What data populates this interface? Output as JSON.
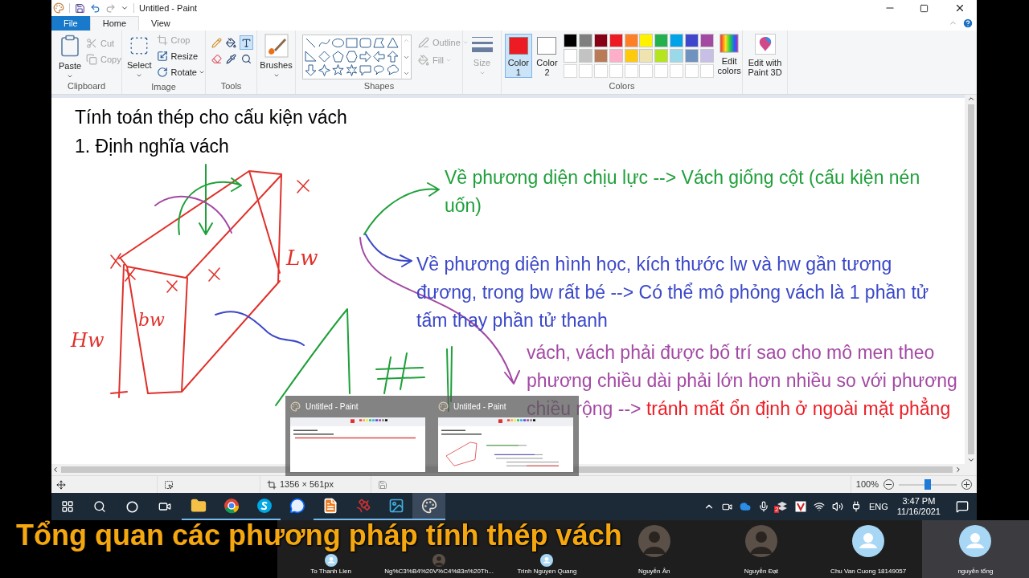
{
  "window": {
    "title": "Untitled - Paint"
  },
  "menu_tabs": [
    {
      "label": "File",
      "kind": "file",
      "selected": false
    },
    {
      "label": "Home",
      "kind": "tab",
      "selected": true
    },
    {
      "label": "View",
      "kind": "tab",
      "selected": false
    }
  ],
  "ribbon": {
    "clipboard": {
      "label": "Clipboard",
      "paste": "Paste",
      "cut": {
        "label": "Cut",
        "disabled": true
      },
      "copy": {
        "label": "Copy",
        "disabled": true
      }
    },
    "image": {
      "label": "Image",
      "select": "Select",
      "crop": {
        "label": "Crop",
        "disabled": true
      },
      "resize": {
        "label": "Resize",
        "disabled": false
      },
      "rotate": {
        "label": "Rotate",
        "disabled": false
      }
    },
    "tools": {
      "label": "Tools",
      "items": [
        {
          "kind": "pencil",
          "selected": false
        },
        {
          "kind": "fill",
          "selected": false
        },
        {
          "kind": "text",
          "selected": true
        },
        {
          "kind": "eraser",
          "selected": false
        },
        {
          "kind": "picker",
          "selected": false
        },
        {
          "kind": "magnifier",
          "selected": false
        }
      ]
    },
    "brushes": "Brushes",
    "shapes": {
      "label": "Shapes",
      "outline": {
        "label": "Outline",
        "disabled": true
      },
      "fill": {
        "label": "Fill",
        "disabled": true
      }
    },
    "size": {
      "label": "Size",
      "disabled": true
    },
    "colors": {
      "label": "Colors",
      "color1": {
        "label": "Color 1",
        "color": "#ed1c24",
        "selected": true
      },
      "color2": {
        "label": "Color 2",
        "color": "#ffffff",
        "selected": false
      },
      "palette": [
        {
          "color": "#000000"
        },
        {
          "color": "#7f7f7f"
        },
        {
          "color": "#880015"
        },
        {
          "color": "#ed1c24"
        },
        {
          "color": "#ff7f27"
        },
        {
          "color": "#fff200"
        },
        {
          "color": "#22b14c"
        },
        {
          "color": "#00a2e8"
        },
        {
          "color": "#3f48cc"
        },
        {
          "color": "#a349a4"
        },
        {
          "color": "#ffffff"
        },
        {
          "color": "#c3c3c3"
        },
        {
          "color": "#b97a57"
        },
        {
          "color": "#ffaec9"
        },
        {
          "color": "#ffc90e"
        },
        {
          "color": "#efe4b0"
        },
        {
          "color": "#b5e61d"
        },
        {
          "color": "#99d9ea"
        },
        {
          "color": "#7092be"
        },
        {
          "color": "#c8bfe7"
        }
      ],
      "edit_colors": "Edit colors"
    },
    "paint3d": "Edit with Paint 3D"
  },
  "canvas": {
    "heading_lines": [
      "Tính toán thép cho cấu kiện vách",
      "1. Định nghĩa vách"
    ],
    "paragraphs": [
      {
        "segments": [
          {
            "text": "Về phương diện chịu lực --> Vách giống cột (cấu kiện nén uốn)",
            "color": "#1fa03a"
          }
        ]
      },
      {
        "segments": [
          {
            "text": "Về phương diện hình học, kích thước lw và hw gần tương đương, trong bw rất bé --> Có thể mô phỏng vách là 1 phần tử tấm thay phần tử thanh",
            "color": "#3b48c8"
          }
        ]
      },
      {
        "segments": [
          {
            "text": "vách, vách phải được bố trí sao cho mô men theo phương chiều dài phải lớn hơn nhiều so với phương chiều rộng --> ",
            "color": "#a349a4"
          },
          {
            "text": "tránh mất ổn định ở ngoài mặt phẳng",
            "color": "#ed1c24"
          }
        ]
      }
    ],
    "sketch_labels": [
      "Lw",
      "Hw",
      "bw"
    ]
  },
  "status_bar": {
    "canvas_size": "1356 × 561px",
    "zoom": "100%",
    "zoom_slider": {
      "level": 0.5
    }
  },
  "thumbnails": [
    {
      "title": "Untitled - Paint"
    },
    {
      "title": "Untitled - Paint"
    }
  ],
  "taskbar": {
    "apps": [
      {
        "kind": "explorer",
        "running": true,
        "active": false
      },
      {
        "kind": "chrome",
        "running": true,
        "active": false
      },
      {
        "kind": "skype",
        "running": true,
        "active": false
      },
      {
        "kind": "zalo",
        "running": false,
        "active": false
      },
      {
        "kind": "pdf",
        "running": true,
        "active": false
      },
      {
        "kind": "satellite",
        "running": true,
        "active": false
      },
      {
        "kind": "photos",
        "running": true,
        "active": false
      },
      {
        "kind": "paint",
        "running": true,
        "active": true
      }
    ],
    "dropbox_badge": "2",
    "language": "ENG",
    "time": "3:47 PM",
    "date": "11/16/2021"
  },
  "meeting": {
    "caption": "Tổng quan các phương pháp tính thép vách",
    "participants": [
      {
        "name": "To Thanh Lien",
        "kind": "default",
        "selected": false
      },
      {
        "name": "Ng%C3%B4%20V%C4%83n%20Th...",
        "selected": false
      },
      {
        "name": "Trinh Nguyen Quang",
        "kind": "default",
        "selected": false
      },
      {
        "name": "Nguyễn Ân",
        "selected": false
      },
      {
        "name": "Nguyễn Đạt",
        "selected": false
      },
      {
        "name": "Chu Van Cuong 18149057",
        "kind": "default",
        "selected": false
      },
      {
        "name": "nguyễn tổng",
        "kind": "default",
        "selected": true
      }
    ]
  }
}
